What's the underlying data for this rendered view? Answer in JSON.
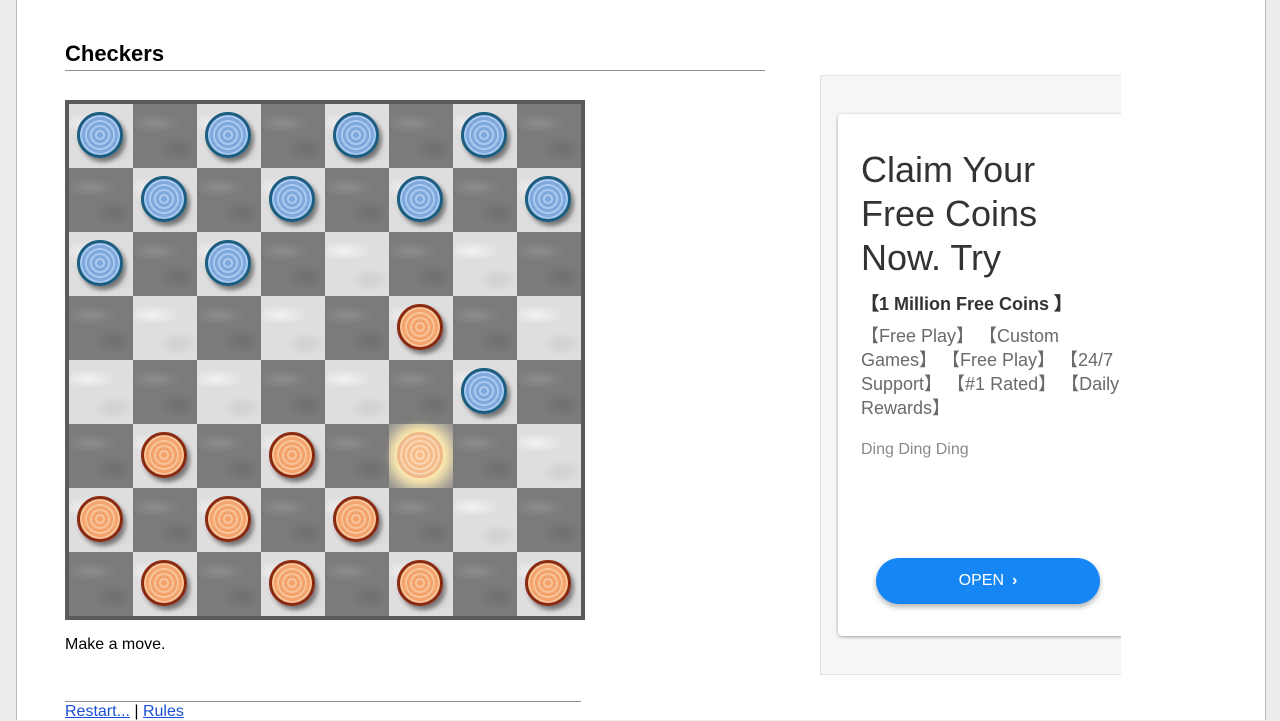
{
  "title": "Checkers",
  "board": {
    "rows": [
      [
        "b",
        "",
        "b",
        "",
        "b",
        "",
        "b",
        ""
      ],
      [
        "",
        "b",
        "",
        "b",
        "",
        "b",
        "",
        "b"
      ],
      [
        "b",
        "",
        "b",
        "",
        "",
        "",
        "",
        ""
      ],
      [
        "",
        "",
        "",
        "",
        "",
        "o",
        "",
        ""
      ],
      [
        "",
        "",
        "",
        "",
        "",
        "",
        "b",
        ""
      ],
      [
        "",
        "o",
        "",
        "o",
        "",
        "s",
        "",
        ""
      ],
      [
        "o",
        "",
        "o",
        "",
        "o",
        "",
        "",
        ""
      ],
      [
        "",
        "o",
        "",
        "o",
        "",
        "o",
        "",
        "o"
      ]
    ],
    "piece_colors": {
      "blue": "#7ea9dc",
      "orange": "#f3a36b",
      "selected": "#f6bd8a"
    }
  },
  "status": "Make a move.",
  "footer": {
    "restart_label": "Restart...",
    "separator": " | ",
    "rules_label": "Rules"
  },
  "ad": {
    "headline": "Claim Your Free Coins Now. Try",
    "subheadline": "【1 Million Free Coins 】",
    "description": "【Free Play】 【Custom Games】 【Free Play】 【24/7 Support】 【#1 Rated】 【Daily Rewards】",
    "advertiser": "Ding Ding Ding",
    "button_label": "OPEN",
    "button_color": "#1686f5"
  }
}
